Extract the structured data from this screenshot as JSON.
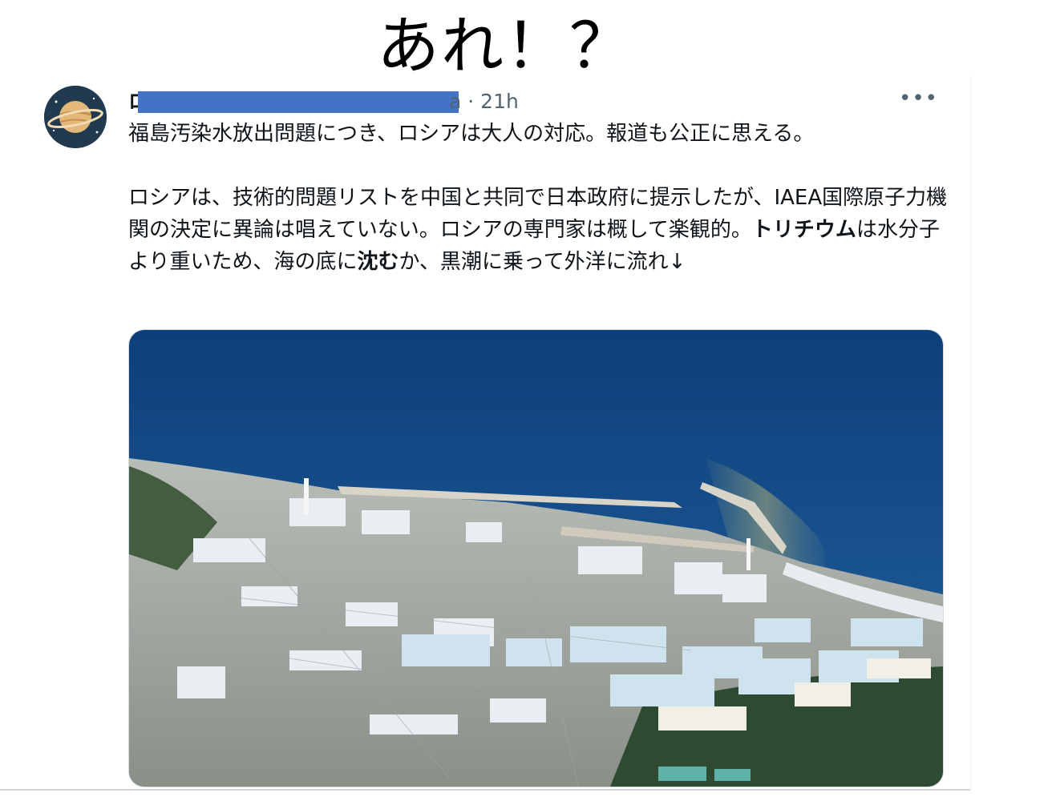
{
  "headline": "あれ！？",
  "tweet": {
    "author_name": "ロ",
    "handle_tail": "a · 21h",
    "more_label": "•••",
    "line1": "福島汚染水放出問題につき、ロシアは大人の対応。報道も公正に思える。",
    "para2_a": "ロシアは、技術的問題リストを中国と共同で日本政府に提示したが、IAEA国際原子力機関の決定に異論は唱えていない。ロシアの専門家は概して楽観的。",
    "bold_1": "トリチウム",
    "para2_b": "は水分子より重いため、海の底に",
    "bold_2": "沈む",
    "para2_c": "か、黒潮に乗って外洋に流れ↓"
  },
  "colors": {
    "redaction": "#4472c4",
    "text": "#0f1419",
    "secondary": "#536471",
    "sea": "#1d4f86"
  },
  "icons": {
    "avatar": "saturn-planet-avatar",
    "more": "more-icon"
  }
}
